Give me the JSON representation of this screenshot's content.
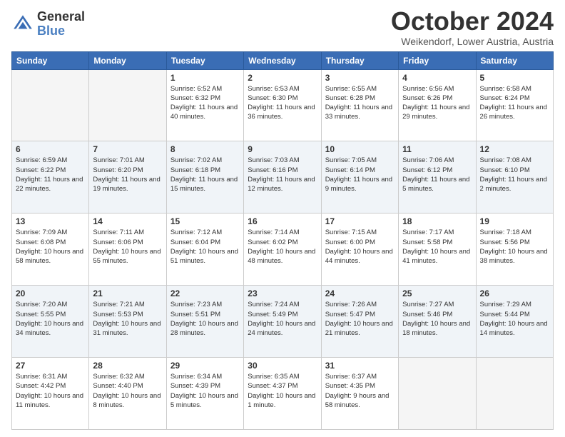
{
  "header": {
    "logo_general": "General",
    "logo_blue": "Blue",
    "month_title": "October 2024",
    "location": "Weikendorf, Lower Austria, Austria"
  },
  "days_of_week": [
    "Sunday",
    "Monday",
    "Tuesday",
    "Wednesday",
    "Thursday",
    "Friday",
    "Saturday"
  ],
  "weeks": [
    [
      {
        "day": "",
        "info": ""
      },
      {
        "day": "",
        "info": ""
      },
      {
        "day": "1",
        "info": "Sunrise: 6:52 AM\nSunset: 6:32 PM\nDaylight: 11 hours and 40 minutes."
      },
      {
        "day": "2",
        "info": "Sunrise: 6:53 AM\nSunset: 6:30 PM\nDaylight: 11 hours and 36 minutes."
      },
      {
        "day": "3",
        "info": "Sunrise: 6:55 AM\nSunset: 6:28 PM\nDaylight: 11 hours and 33 minutes."
      },
      {
        "day": "4",
        "info": "Sunrise: 6:56 AM\nSunset: 6:26 PM\nDaylight: 11 hours and 29 minutes."
      },
      {
        "day": "5",
        "info": "Sunrise: 6:58 AM\nSunset: 6:24 PM\nDaylight: 11 hours and 26 minutes."
      }
    ],
    [
      {
        "day": "6",
        "info": "Sunrise: 6:59 AM\nSunset: 6:22 PM\nDaylight: 11 hours and 22 minutes."
      },
      {
        "day": "7",
        "info": "Sunrise: 7:01 AM\nSunset: 6:20 PM\nDaylight: 11 hours and 19 minutes."
      },
      {
        "day": "8",
        "info": "Sunrise: 7:02 AM\nSunset: 6:18 PM\nDaylight: 11 hours and 15 minutes."
      },
      {
        "day": "9",
        "info": "Sunrise: 7:03 AM\nSunset: 6:16 PM\nDaylight: 11 hours and 12 minutes."
      },
      {
        "day": "10",
        "info": "Sunrise: 7:05 AM\nSunset: 6:14 PM\nDaylight: 11 hours and 9 minutes."
      },
      {
        "day": "11",
        "info": "Sunrise: 7:06 AM\nSunset: 6:12 PM\nDaylight: 11 hours and 5 minutes."
      },
      {
        "day": "12",
        "info": "Sunrise: 7:08 AM\nSunset: 6:10 PM\nDaylight: 11 hours and 2 minutes."
      }
    ],
    [
      {
        "day": "13",
        "info": "Sunrise: 7:09 AM\nSunset: 6:08 PM\nDaylight: 10 hours and 58 minutes."
      },
      {
        "day": "14",
        "info": "Sunrise: 7:11 AM\nSunset: 6:06 PM\nDaylight: 10 hours and 55 minutes."
      },
      {
        "day": "15",
        "info": "Sunrise: 7:12 AM\nSunset: 6:04 PM\nDaylight: 10 hours and 51 minutes."
      },
      {
        "day": "16",
        "info": "Sunrise: 7:14 AM\nSunset: 6:02 PM\nDaylight: 10 hours and 48 minutes."
      },
      {
        "day": "17",
        "info": "Sunrise: 7:15 AM\nSunset: 6:00 PM\nDaylight: 10 hours and 44 minutes."
      },
      {
        "day": "18",
        "info": "Sunrise: 7:17 AM\nSunset: 5:58 PM\nDaylight: 10 hours and 41 minutes."
      },
      {
        "day": "19",
        "info": "Sunrise: 7:18 AM\nSunset: 5:56 PM\nDaylight: 10 hours and 38 minutes."
      }
    ],
    [
      {
        "day": "20",
        "info": "Sunrise: 7:20 AM\nSunset: 5:55 PM\nDaylight: 10 hours and 34 minutes."
      },
      {
        "day": "21",
        "info": "Sunrise: 7:21 AM\nSunset: 5:53 PM\nDaylight: 10 hours and 31 minutes."
      },
      {
        "day": "22",
        "info": "Sunrise: 7:23 AM\nSunset: 5:51 PM\nDaylight: 10 hours and 28 minutes."
      },
      {
        "day": "23",
        "info": "Sunrise: 7:24 AM\nSunset: 5:49 PM\nDaylight: 10 hours and 24 minutes."
      },
      {
        "day": "24",
        "info": "Sunrise: 7:26 AM\nSunset: 5:47 PM\nDaylight: 10 hours and 21 minutes."
      },
      {
        "day": "25",
        "info": "Sunrise: 7:27 AM\nSunset: 5:46 PM\nDaylight: 10 hours and 18 minutes."
      },
      {
        "day": "26",
        "info": "Sunrise: 7:29 AM\nSunset: 5:44 PM\nDaylight: 10 hours and 14 minutes."
      }
    ],
    [
      {
        "day": "27",
        "info": "Sunrise: 6:31 AM\nSunset: 4:42 PM\nDaylight: 10 hours and 11 minutes."
      },
      {
        "day": "28",
        "info": "Sunrise: 6:32 AM\nSunset: 4:40 PM\nDaylight: 10 hours and 8 minutes."
      },
      {
        "day": "29",
        "info": "Sunrise: 6:34 AM\nSunset: 4:39 PM\nDaylight: 10 hours and 5 minutes."
      },
      {
        "day": "30",
        "info": "Sunrise: 6:35 AM\nSunset: 4:37 PM\nDaylight: 10 hours and 1 minute."
      },
      {
        "day": "31",
        "info": "Sunrise: 6:37 AM\nSunset: 4:35 PM\nDaylight: 9 hours and 58 minutes."
      },
      {
        "day": "",
        "info": ""
      },
      {
        "day": "",
        "info": ""
      }
    ]
  ]
}
